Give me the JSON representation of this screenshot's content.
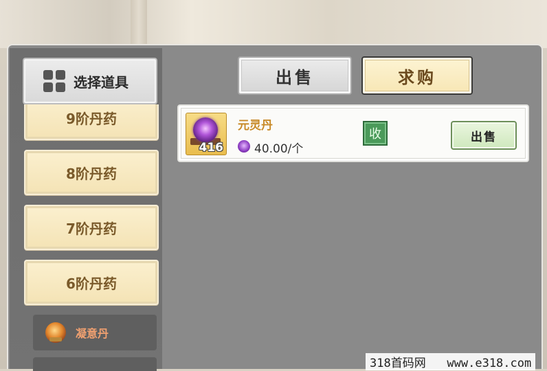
{
  "header": {
    "select_item_label": "选择道具"
  },
  "tabs": [
    {
      "label": "出售",
      "active": false
    },
    {
      "label": "求购",
      "active": true
    }
  ],
  "categories": [
    {
      "label": "9阶丹药"
    },
    {
      "label": "8阶丹药"
    },
    {
      "label": "7阶丹药"
    },
    {
      "label": "6阶丹药"
    }
  ],
  "subcategory": {
    "label": "凝意丹",
    "icon": "pill-icon"
  },
  "listing": {
    "item_name": "元灵丹",
    "quantity": "416",
    "price": "40.00/个",
    "price_icon": "spirit-coin-icon",
    "status_badge": "收",
    "action_label": "出售"
  },
  "watermark": "318首码网   www.e318.com",
  "colors": {
    "panel_bg": "#8a8a8a",
    "category_bg": "#f7e8bd",
    "item_name": "#c88a28",
    "badge_green": "#4a9a5a",
    "sell_button": "#d7eec6"
  }
}
